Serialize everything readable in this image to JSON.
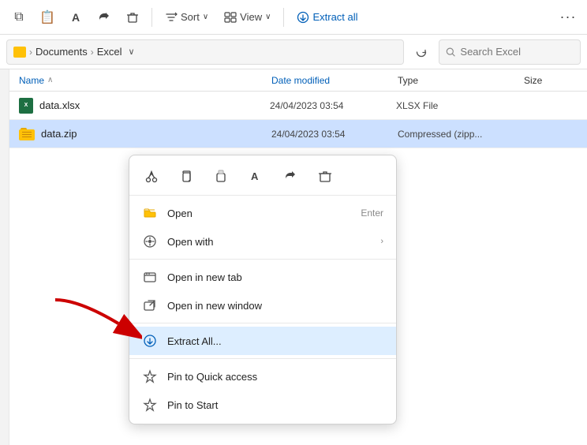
{
  "toolbar": {
    "icons": [
      {
        "name": "copy-icon",
        "symbol": "⧉",
        "label": "Copy"
      },
      {
        "name": "paste-icon",
        "symbol": "📋",
        "label": "Paste"
      },
      {
        "name": "font-icon",
        "symbol": "Ａ",
        "label": "Font"
      },
      {
        "name": "share-icon",
        "symbol": "↗",
        "label": "Share"
      },
      {
        "name": "delete-icon",
        "symbol": "🗑",
        "label": "Delete"
      }
    ],
    "sort_label": "Sort",
    "view_label": "View",
    "extract_label": "Extract all",
    "more_label": "..."
  },
  "addressbar": {
    "folder_icon": "📁",
    "breadcrumb": "Documents › Excel",
    "breadcrumb_parts": [
      "Documents",
      "Excel"
    ],
    "search_placeholder": "Search Excel"
  },
  "columns": {
    "name": "Name",
    "date_modified": "Date modified",
    "type": "Type",
    "size": "Size"
  },
  "files": [
    {
      "name": "data.xlsx",
      "date_modified": "24/04/2023 03:54",
      "type": "XLSX File",
      "size": "",
      "icon": "xlsx"
    },
    {
      "name": "data.zip",
      "date_modified": "24/04/2023 03:54",
      "type": "Compressed (zipp...",
      "size": "",
      "icon": "zip"
    }
  ],
  "context_menu": {
    "toolbar_icons": [
      {
        "name": "cut-icon",
        "symbol": "✂",
        "label": "Cut"
      },
      {
        "name": "copy-ctx-icon",
        "symbol": "⧉",
        "label": "Copy"
      },
      {
        "name": "paste-ctx-icon",
        "symbol": "📋",
        "label": "Paste"
      },
      {
        "name": "rename-icon",
        "symbol": "Ａ",
        "label": "Rename"
      },
      {
        "name": "share-ctx-icon",
        "symbol": "↗",
        "label": "Share"
      },
      {
        "name": "delete-ctx-icon",
        "symbol": "🗑",
        "label": "Delete"
      }
    ],
    "items": [
      {
        "label": "Open",
        "shortcut": "Enter",
        "arrow": false,
        "icon": "📂",
        "icon_name": "open-icon"
      },
      {
        "label": "Open with",
        "shortcut": "",
        "arrow": true,
        "icon": "⚙",
        "icon_name": "open-with-icon"
      },
      {
        "label": "Open in new tab",
        "shortcut": "",
        "arrow": false,
        "icon": "⬚",
        "icon_name": "new-tab-icon"
      },
      {
        "label": "Open in new window",
        "shortcut": "",
        "arrow": false,
        "icon": "⧉",
        "icon_name": "new-window-icon"
      },
      {
        "label": "Extract All...",
        "shortcut": "",
        "arrow": false,
        "icon": "⊞",
        "icon_name": "extract-icon",
        "highlighted": true
      },
      {
        "label": "Pin to Quick access",
        "shortcut": "",
        "arrow": false,
        "icon": "✦",
        "icon_name": "pin-quick-icon"
      },
      {
        "label": "Pin to Start",
        "shortcut": "",
        "arrow": false,
        "icon": "✦",
        "icon_name": "pin-start-icon"
      }
    ]
  }
}
